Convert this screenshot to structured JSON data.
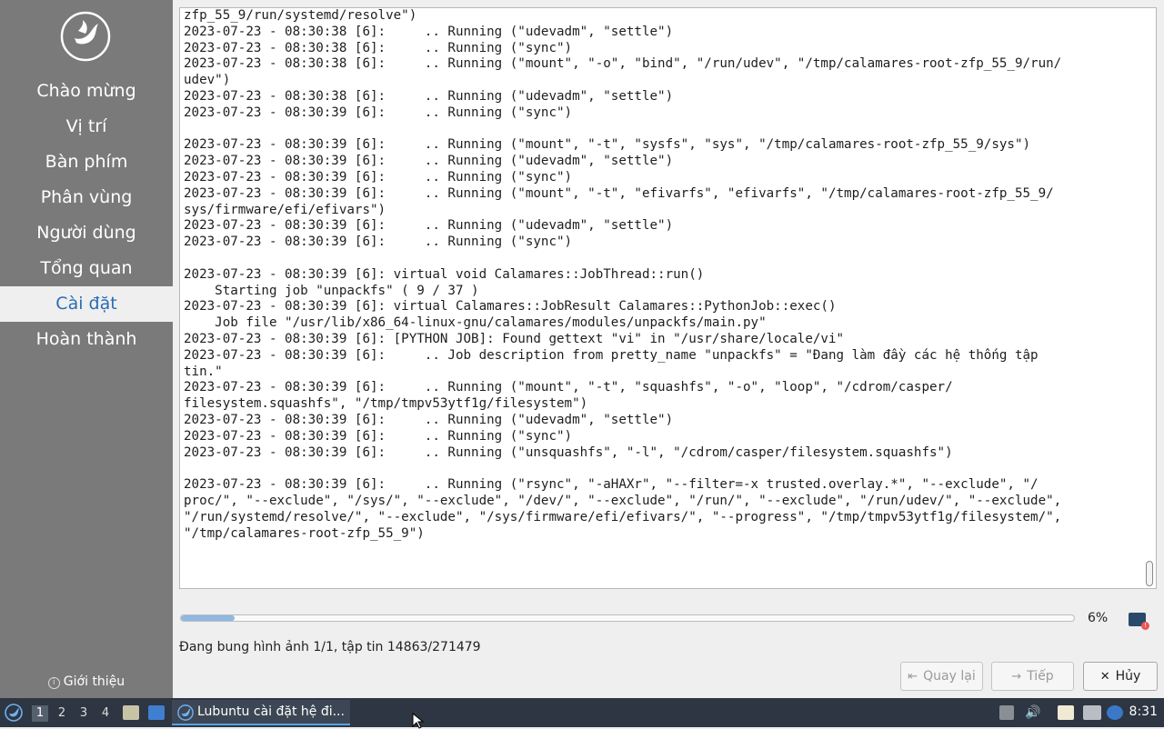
{
  "sidebar": {
    "steps": [
      {
        "label": "Chào mừng"
      },
      {
        "label": "Vị trí"
      },
      {
        "label": "Bàn phím"
      },
      {
        "label": "Phân vùng"
      },
      {
        "label": "Người dùng"
      },
      {
        "label": "Tổng quan"
      },
      {
        "label": "Cài đặt"
      },
      {
        "label": "Hoàn thành"
      }
    ],
    "active_step": "Cài đặt",
    "about_label": "Giới thiệu"
  },
  "log": {
    "lines": [
      "zfp_55_9/run/systemd/resolve\")",
      "2023-07-23 - 08:30:38 [6]:     .. Running (\"udevadm\", \"settle\")",
      "2023-07-23 - 08:30:38 [6]:     .. Running (\"sync\")",
      "2023-07-23 - 08:30:38 [6]:     .. Running (\"mount\", \"-o\", \"bind\", \"/run/udev\", \"/tmp/calamares-root-zfp_55_9/run/",
      "udev\")",
      "2023-07-23 - 08:30:38 [6]:     .. Running (\"udevadm\", \"settle\")",
      "2023-07-23 - 08:30:39 [6]:     .. Running (\"sync\")",
      "",
      "2023-07-23 - 08:30:39 [6]:     .. Running (\"mount\", \"-t\", \"sysfs\", \"sys\", \"/tmp/calamares-root-zfp_55_9/sys\")",
      "2023-07-23 - 08:30:39 [6]:     .. Running (\"udevadm\", \"settle\")",
      "2023-07-23 - 08:30:39 [6]:     .. Running (\"sync\")",
      "2023-07-23 - 08:30:39 [6]:     .. Running (\"mount\", \"-t\", \"efivarfs\", \"efivarfs\", \"/tmp/calamares-root-zfp_55_9/",
      "sys/firmware/efi/efivars\")",
      "2023-07-23 - 08:30:39 [6]:     .. Running (\"udevadm\", \"settle\")",
      "2023-07-23 - 08:30:39 [6]:     .. Running (\"sync\")",
      "",
      "2023-07-23 - 08:30:39 [6]: virtual void Calamares::JobThread::run()",
      "    Starting job \"unpackfs\" ( 9 / 37 )",
      "2023-07-23 - 08:30:39 [6]: virtual Calamares::JobResult Calamares::PythonJob::exec()",
      "    Job file \"/usr/lib/x86_64-linux-gnu/calamares/modules/unpackfs/main.py\"",
      "2023-07-23 - 08:30:39 [6]: [PYTHON JOB]: Found gettext \"vi\" in \"/usr/share/locale/vi\"",
      "2023-07-23 - 08:30:39 [6]:     .. Job description from pretty_name \"unpackfs\" = \"Đang làm đầy các hệ thống tập",
      "tin.\"",
      "2023-07-23 - 08:30:39 [6]:     .. Running (\"mount\", \"-t\", \"squashfs\", \"-o\", \"loop\", \"/cdrom/casper/",
      "filesystem.squashfs\", \"/tmp/tmpv53ytf1g/filesystem\")",
      "2023-07-23 - 08:30:39 [6]:     .. Running (\"udevadm\", \"settle\")",
      "2023-07-23 - 08:30:39 [6]:     .. Running (\"sync\")",
      "2023-07-23 - 08:30:39 [6]:     .. Running (\"unsquashfs\", \"-l\", \"/cdrom/casper/filesystem.squashfs\")",
      "",
      "2023-07-23 - 08:30:39 [6]:     .. Running (\"rsync\", \"-aHAXr\", \"--filter=-x trusted.overlay.*\", \"--exclude\", \"/",
      "proc/\", \"--exclude\", \"/sys/\", \"--exclude\", \"/dev/\", \"--exclude\", \"/run/\", \"--exclude\", \"/run/udev/\", \"--exclude\",",
      "\"/run/systemd/resolve/\", \"--exclude\", \"/sys/firmware/efi/efivars/\", \"--progress\", \"/tmp/tmpv53ytf1g/filesystem/\",",
      "\"/tmp/calamares-root-zfp_55_9\")"
    ]
  },
  "progress": {
    "fraction": 0.06,
    "percent_label": "6%",
    "status_text": "Đang bung hình ảnh 1/1, tập tin 14863/271479"
  },
  "buttons": {
    "back_label": "Quay lại",
    "next_label": "Tiếp",
    "cancel_label": "Hủy"
  },
  "taskbar": {
    "workspaces": [
      "1",
      "2",
      "3",
      "4"
    ],
    "active_workspace": "1",
    "task_label": "Lubuntu cài đặt hệ đi...",
    "clock": "8:31"
  },
  "colors": {
    "sidebar_bg": "#7a7a7a",
    "active_step_text": "#2a6db5",
    "progress_fill": "#8fb7e0",
    "taskbar_bg": "#2d3642"
  }
}
